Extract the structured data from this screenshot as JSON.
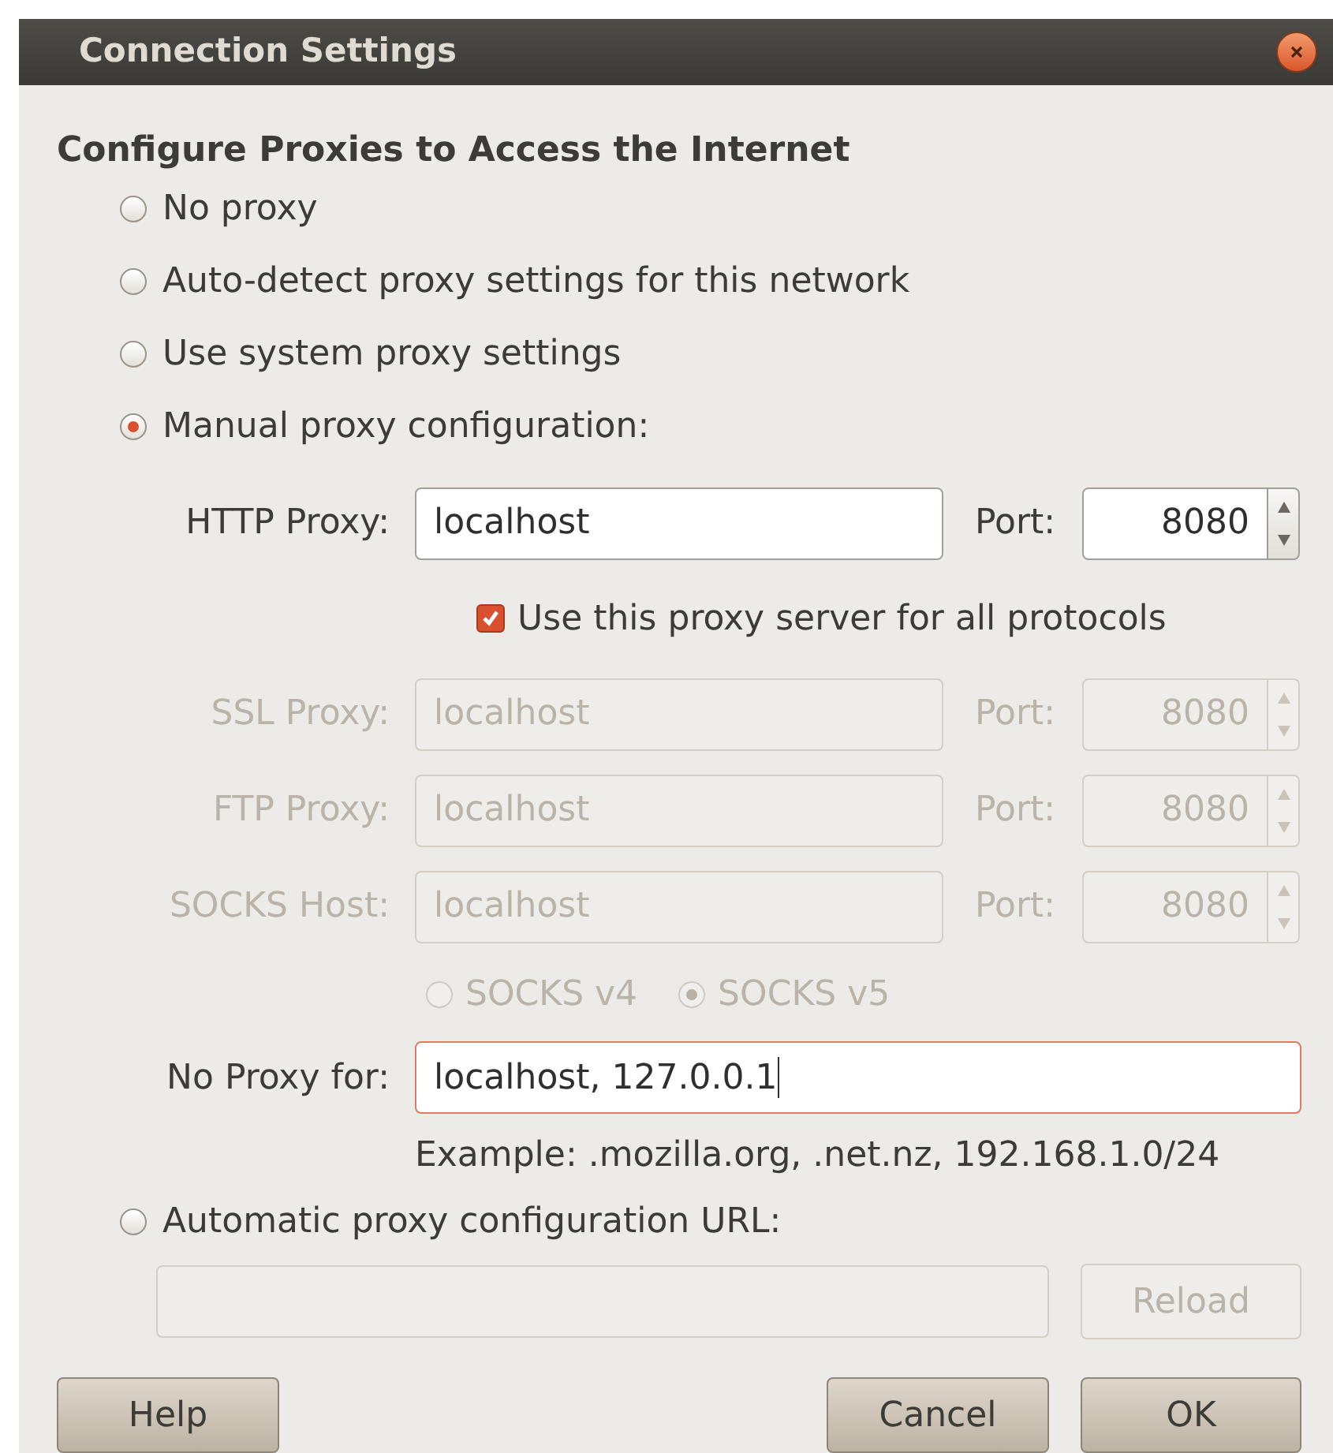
{
  "window": {
    "title": "Connection Settings"
  },
  "heading": "Configure Proxies to Access the Internet",
  "modes": [
    {
      "label": "No proxy",
      "selected": false
    },
    {
      "label": "Auto-detect proxy settings for this network",
      "selected": false
    },
    {
      "label": "Use system proxy settings",
      "selected": false
    },
    {
      "label": "Manual proxy configuration:",
      "selected": true
    }
  ],
  "proxies": [
    {
      "label": "HTTP Proxy:",
      "value": "localhost",
      "port_label": "Port:",
      "port": "8080",
      "disabled": false
    },
    {
      "label": "SSL Proxy:",
      "value": "localhost",
      "port_label": "Port:",
      "port": "8080",
      "disabled": true
    },
    {
      "label": "FTP Proxy:",
      "value": "localhost",
      "port_label": "Port:",
      "port": "8080",
      "disabled": true
    },
    {
      "label": "SOCKS Host:",
      "value": "localhost",
      "port_label": "Port:",
      "port": "8080",
      "disabled": true
    }
  ],
  "share_all": {
    "label": "Use this proxy server for all protocols",
    "checked": true
  },
  "socks_versions": [
    {
      "label": "SOCKS v4",
      "selected": false,
      "disabled": true
    },
    {
      "label": "SOCKS v5",
      "selected": true,
      "disabled": true
    }
  ],
  "no_proxy": {
    "label": "No Proxy for:",
    "value": "localhost, 127.0.0.1",
    "focused": true
  },
  "example": "Example: .mozilla.org, .net.nz, 192.168.1.0/24",
  "auto_mode": {
    "label": "Automatic proxy configuration URL:",
    "selected": false
  },
  "reload": {
    "label": "Reload",
    "disabled": true
  },
  "buttons": [
    {
      "label": "Help",
      "kind": "help"
    },
    {
      "label": "Cancel",
      "kind": "cancel"
    },
    {
      "label": "OK",
      "kind": "ok"
    }
  ]
}
